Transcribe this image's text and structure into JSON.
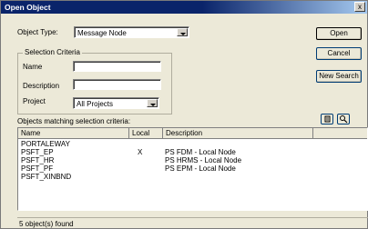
{
  "window": {
    "title": "Open Object",
    "close_glyph": "x"
  },
  "form": {
    "object_type_label": "Object Type:",
    "object_type_value": "Message Node",
    "selection_criteria_label": "Selection Criteria",
    "name_label": "Name",
    "name_value": "",
    "description_label": "Description",
    "description_value": "",
    "project_label": "Project",
    "project_value": "All Projects"
  },
  "buttons": {
    "open": "Open",
    "cancel": "Cancel",
    "new_search": "New Search"
  },
  "results": {
    "label": "Objects matching selection criteria:",
    "columns": [
      "Name",
      "Local",
      "Description"
    ],
    "rows": [
      {
        "name": "PORTALEWAY",
        "local": "",
        "description": ""
      },
      {
        "name": "PSFT_EP",
        "local": "X",
        "description": "PS FDM - Local Node"
      },
      {
        "name": "PSFT_HR",
        "local": "",
        "description": "PS HRMS - Local Node"
      },
      {
        "name": "PSFT_PF",
        "local": "",
        "description": "PS EPM - Local Node"
      },
      {
        "name": "PSFT_XINBND",
        "local": "",
        "description": ""
      }
    ]
  },
  "status": {
    "text": "5 object(s) found"
  },
  "icons": {
    "list_view_icon": "list-view-icon",
    "search_icon": "magnifier-icon"
  }
}
